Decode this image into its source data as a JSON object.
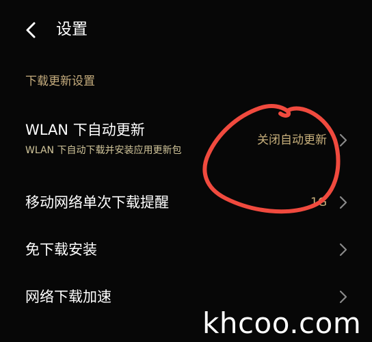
{
  "header": {
    "back_icon": "chevron-left-icon",
    "title": "设置"
  },
  "section": {
    "title": "下载更新设置"
  },
  "rows": [
    {
      "title": "WLAN 下自动更新",
      "subtitle": "WLAN 下自动下载并安装应用更新包",
      "value": "关闭自动更新",
      "chevron_icon": "chevron-right-icon"
    },
    {
      "title": "移动网络单次下载提醒",
      "value": "1G",
      "chevron_icon": "chevron-right-icon"
    },
    {
      "title": "免下载安装",
      "chevron_icon": "chevron-right-icon"
    },
    {
      "title": "网络下载加速",
      "chevron_icon": "chevron-right-icon"
    }
  ],
  "watermark": "khcoo.com",
  "colors": {
    "background": "#070707",
    "section_header": "#c6ad7e",
    "value_text": "#c8b07c",
    "annotation_stroke": "#f04a3e"
  }
}
